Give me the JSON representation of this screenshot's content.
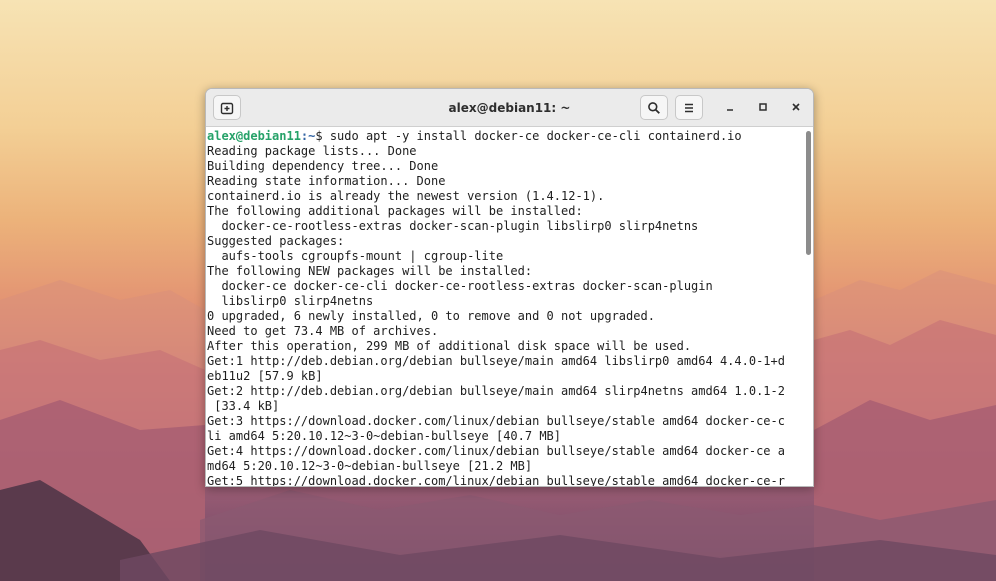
{
  "window": {
    "title": "alex@debian11: ~"
  },
  "terminal": {
    "prompt_user": "alex@debian11",
    "prompt_path": ":~",
    "prompt_symbol": "$ ",
    "command": "sudo apt -y install docker-ce docker-ce-cli containerd.io",
    "output": [
      "Reading package lists... Done",
      "Building dependency tree... Done",
      "Reading state information... Done",
      "containerd.io is already the newest version (1.4.12-1).",
      "The following additional packages will be installed:",
      "  docker-ce-rootless-extras docker-scan-plugin libslirp0 slirp4netns",
      "Suggested packages:",
      "  aufs-tools cgroupfs-mount | cgroup-lite",
      "The following NEW packages will be installed:",
      "  docker-ce docker-ce-cli docker-ce-rootless-extras docker-scan-plugin",
      "  libslirp0 slirp4netns",
      "0 upgraded, 6 newly installed, 0 to remove and 0 not upgraded.",
      "Need to get 73.4 MB of archives.",
      "After this operation, 299 MB of additional disk space will be used.",
      "Get:1 http://deb.debian.org/debian bullseye/main amd64 libslirp0 amd64 4.4.0-1+d",
      "eb11u2 [57.9 kB]",
      "Get:2 http://deb.debian.org/debian bullseye/main amd64 slirp4netns amd64 1.0.1-2",
      " [33.4 kB]",
      "Get:3 https://download.docker.com/linux/debian bullseye/stable amd64 docker-ce-c",
      "li amd64 5:20.10.12~3-0~debian-bullseye [40.7 MB]",
      "Get:4 https://download.docker.com/linux/debian bullseye/stable amd64 docker-ce a",
      "md64 5:20.10.12~3-0~debian-bullseye [21.2 MB]",
      "Get:5 https://download.docker.com/linux/debian bullseye/stable amd64 docker-ce-r"
    ]
  },
  "icons": {
    "new_tab": "new-tab-icon",
    "search": "search-icon",
    "menu": "hamburger-menu-icon",
    "minimize": "minimize-icon",
    "maximize": "maximize-icon",
    "close": "close-icon"
  },
  "colors": {
    "prompt_user": "#26a269",
    "prompt_path": "#3465a4",
    "titlebar": "#ebebeb",
    "terminal_bg": "#ffffff",
    "terminal_fg": "#1e1e1e"
  }
}
